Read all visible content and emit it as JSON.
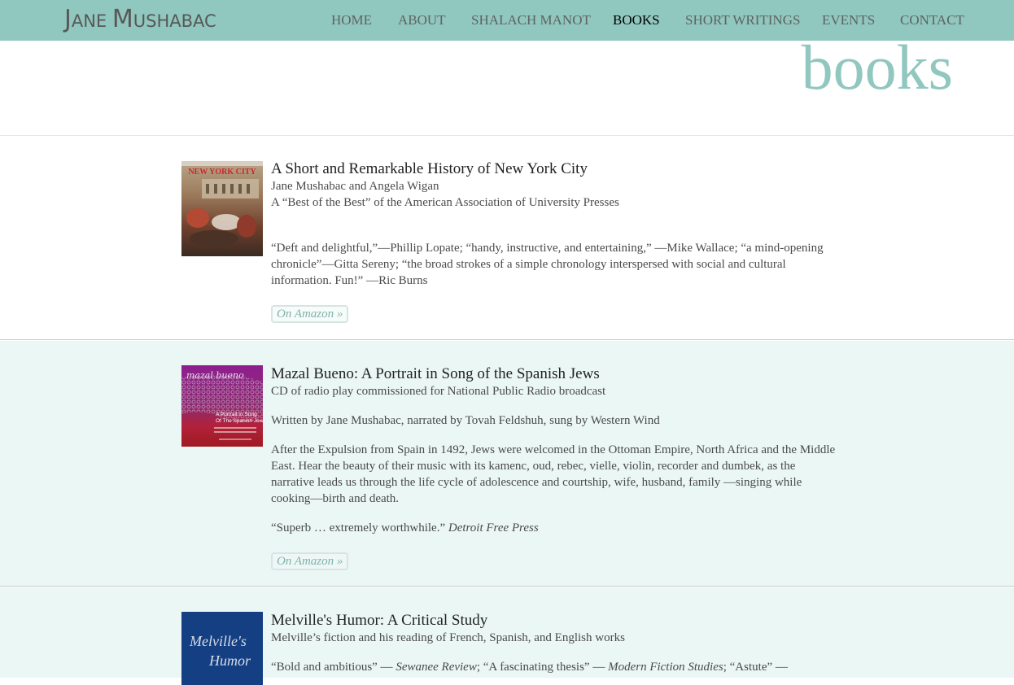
{
  "site": {
    "logo": {
      "first_cap": "J",
      "first_rest": "ANE ",
      "last_cap": "M",
      "last_rest": "USHABAC"
    },
    "nav": [
      {
        "label": "HOME",
        "active": false
      },
      {
        "label": "ABOUT",
        "active": false
      },
      {
        "label": "SHALACH MANOT",
        "active": false
      },
      {
        "label": "BOOKS",
        "active": true
      },
      {
        "label": "SHORT WRITINGS",
        "active": false
      },
      {
        "label": "EVENTS",
        "active": false
      },
      {
        "label": "CONTACT",
        "active": false
      }
    ],
    "colors": {
      "accent": "#90c7bf",
      "alt_row": "#ebf7f5",
      "nav_text": "#5d6461",
      "nav_active": "#000000"
    }
  },
  "page": {
    "title": "books"
  },
  "books": [
    {
      "cover": {
        "icon": "book-cover-new-york-city",
        "text": "NEW YORK CITY"
      },
      "title": "A Short and Remarkable History of New York City",
      "lines": [
        "Jane Mushabac and Angela Wigan",
        "A “Best of the Best” of the American Association of University Presses"
      ],
      "quote": "“Deft and delightful,”—Phillip Lopate; “handy, instructive, and entertaining,” —Mike Wallace; “a mind-opening chronicle”—Gitta Sereny; “the broad strokes of a simple chronology interspersed with social and cultural information. Fun!” —Ric Burns",
      "button": "On Amazon »"
    },
    {
      "cover": {
        "icon": "cd-cover-mazal-bueno",
        "title": "mazal bueno",
        "sub1": "A Portrait in Song",
        "sub2": "Of The Spanish Jews"
      },
      "title": "Mazal Bueno: A Portrait in Song of the Spanish Jews",
      "lines": [
        "CD of radio play commissioned for National Public Radio broadcast"
      ],
      "credits": "Written by Jane Mushabac, narrated by Tovah Feldshuh, sung by Western Wind",
      "description": "After the Expulsion from Spain in 1492, Jews were welcomed in the Ottoman Empire, North Africa and the Middle East. Hear the beauty of their music with its kamenc, oud, rebec, vielle, violin, recorder and dumbek, as the narrative leads us through the life cycle of adolescence and courtship, wife, husband, family —singing while cooking—birth and death.",
      "quote_text": "“Superb … extremely worthwhile.” ",
      "quote_source": "Detroit Free Press",
      "button": "On Amazon »"
    },
    {
      "cover": {
        "icon": "book-cover-melvilles-humor",
        "line1": "Melville's",
        "line2": "Humor"
      },
      "title": "Melville's Humor: A Critical Study",
      "lines": [
        "Melville’s fiction and his reading of French, Spanish, and English works"
      ],
      "quote_parts": [
        {
          "text": "“Bold and ambitious” — ",
          "italic": false
        },
        {
          "text": "Sewanee Review",
          "italic": true
        },
        {
          "text": "; “A fascinating thesis” — ",
          "italic": false
        },
        {
          "text": "Modern Fiction Studies",
          "italic": true
        },
        {
          "text": "; “Astute” —",
          "italic": false
        }
      ]
    }
  ]
}
